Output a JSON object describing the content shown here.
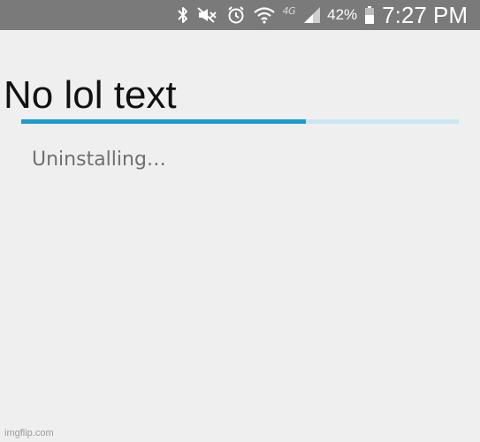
{
  "status_bar": {
    "icons": [
      "bluetooth-icon",
      "mute-icon",
      "alarm-icon",
      "wifi-icon",
      "signal-icon",
      "battery-icon"
    ],
    "network_label": "4G",
    "battery_percent": "42%",
    "time": "7:27 PM"
  },
  "caption": {
    "text": "No lol text"
  },
  "progress": {
    "fraction": 0.65,
    "fill_color": "#1a9bd1",
    "track_color": "#c9e7f2"
  },
  "dialog": {
    "message": "Uninstalling…"
  },
  "watermark": {
    "text": "imgflip.com"
  }
}
